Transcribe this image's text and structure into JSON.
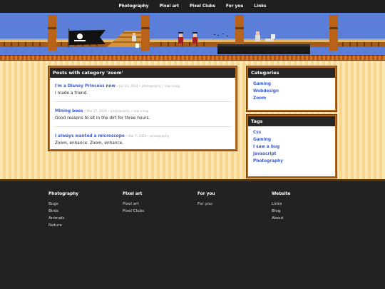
{
  "nav": [
    "Photography",
    "Pixel art",
    "Pixel Clubs",
    "For you",
    "Links"
  ],
  "posts_box": {
    "heading": "Posts with category 'zoom'",
    "posts": [
      {
        "title": "I'm a Disney Princess now",
        "meta": " • Jun 24, 2024 • photography, I saw a bug",
        "excerpt": "I made a friend."
      },
      {
        "title": "Mining bees",
        "meta": " • Mar 27, 2024 • photography, I saw a bug",
        "excerpt": "Good reasons to sit in the dirt for three hours."
      },
      {
        "title": "I always wanted a microscope",
        "meta": " • Mar 7, 2024 • photography",
        "excerpt": "Zoom, enhance. Zoom, enhance."
      }
    ]
  },
  "categories": {
    "heading": "Categories",
    "items": [
      "Gaming",
      "Webdesign",
      "Zoom"
    ]
  },
  "tags": {
    "heading": "Tags",
    "items": [
      "Css",
      "Gaming",
      "I saw a bug",
      "Javascript",
      "Photography"
    ]
  },
  "footer": [
    {
      "heading": "Photography",
      "links": [
        "Bugs",
        "Birds",
        "Animals",
        "Nature"
      ]
    },
    {
      "heading": "Pixel art",
      "links": [
        "Pixel art",
        "Pixel Clubs"
      ]
    },
    {
      "heading": "For you",
      "links": [
        "For you"
      ]
    },
    {
      "heading": "Website",
      "links": [
        "Links",
        "Blog",
        "About"
      ]
    }
  ]
}
